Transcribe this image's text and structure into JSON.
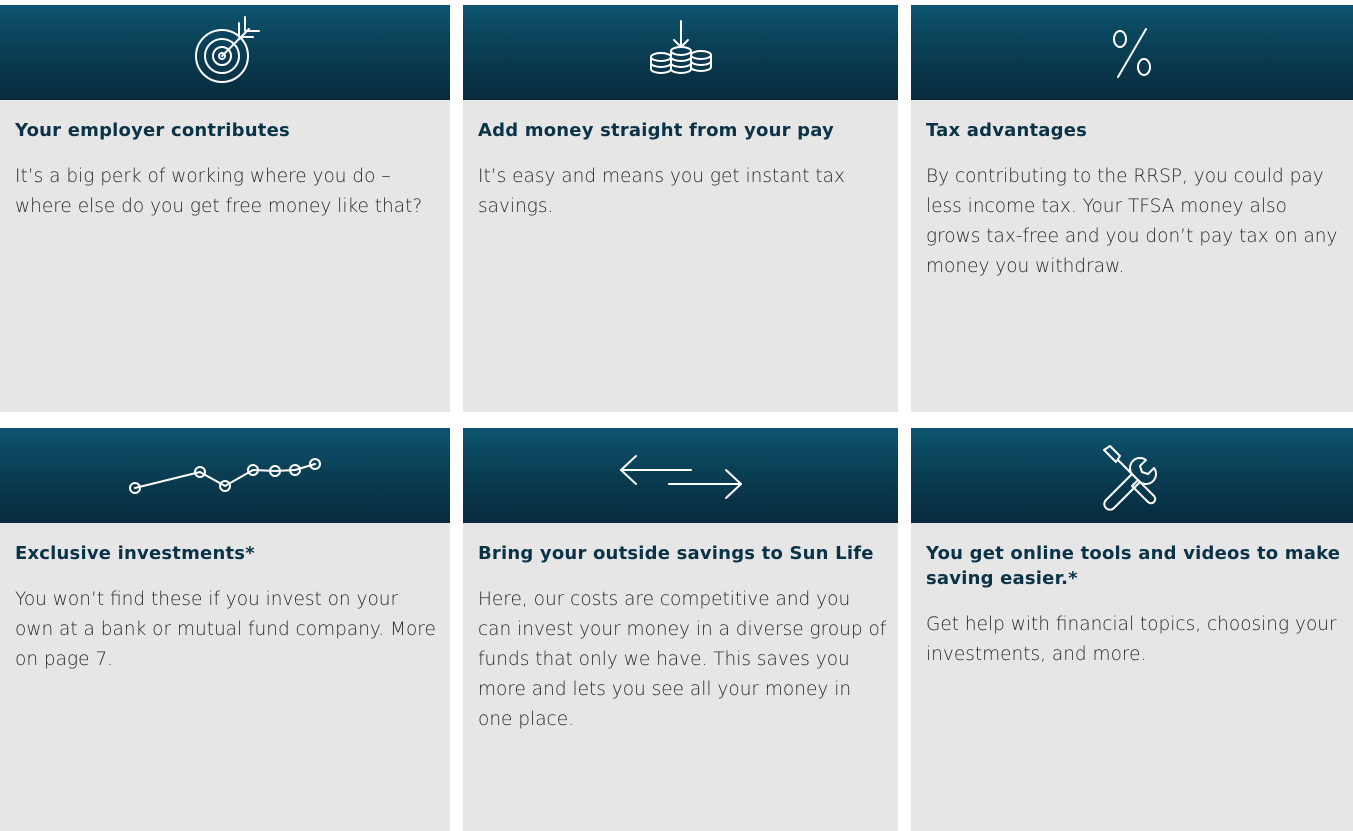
{
  "cards": [
    {
      "icon": "target-icon",
      "title": "Your employer contributes",
      "body": "It’s a big perk of working where you do – where else do you get free money like that?"
    },
    {
      "icon": "coins-arrow-down-icon",
      "title": "Add money straight from your pay",
      "body": "It’s easy and means you get instant tax savings."
    },
    {
      "icon": "percent-icon",
      "title": "Tax advantages",
      "body": "By contributing to the RRSP, you could pay less income tax. Your TFSA money also grows tax-free and you don’t pay tax on any money you withdraw."
    },
    {
      "icon": "line-chart-icon",
      "title": "Exclusive investments*",
      "body": "You won’t find these if you invest on your own at a bank or mutual fund company. More on page 7."
    },
    {
      "icon": "transfer-arrows-icon",
      "title": "Bring your outside savings to Sun Life",
      "body": "Here, our costs are competitive and you can invest your money in a diverse group of funds that only we have. This saves you more and lets you see all your money in one place."
    },
    {
      "icon": "tools-icon",
      "title": "You get online tools and videos to make saving easier.*",
      "body": "Get help with financial topics, choosing your investments, and more."
    }
  ],
  "colors": {
    "header_top": "#0e5570",
    "header_bottom": "#082a3d",
    "card_bg": "#e7e6e7",
    "title_text": "#0a3347",
    "body_text": "#2a2a2a"
  }
}
